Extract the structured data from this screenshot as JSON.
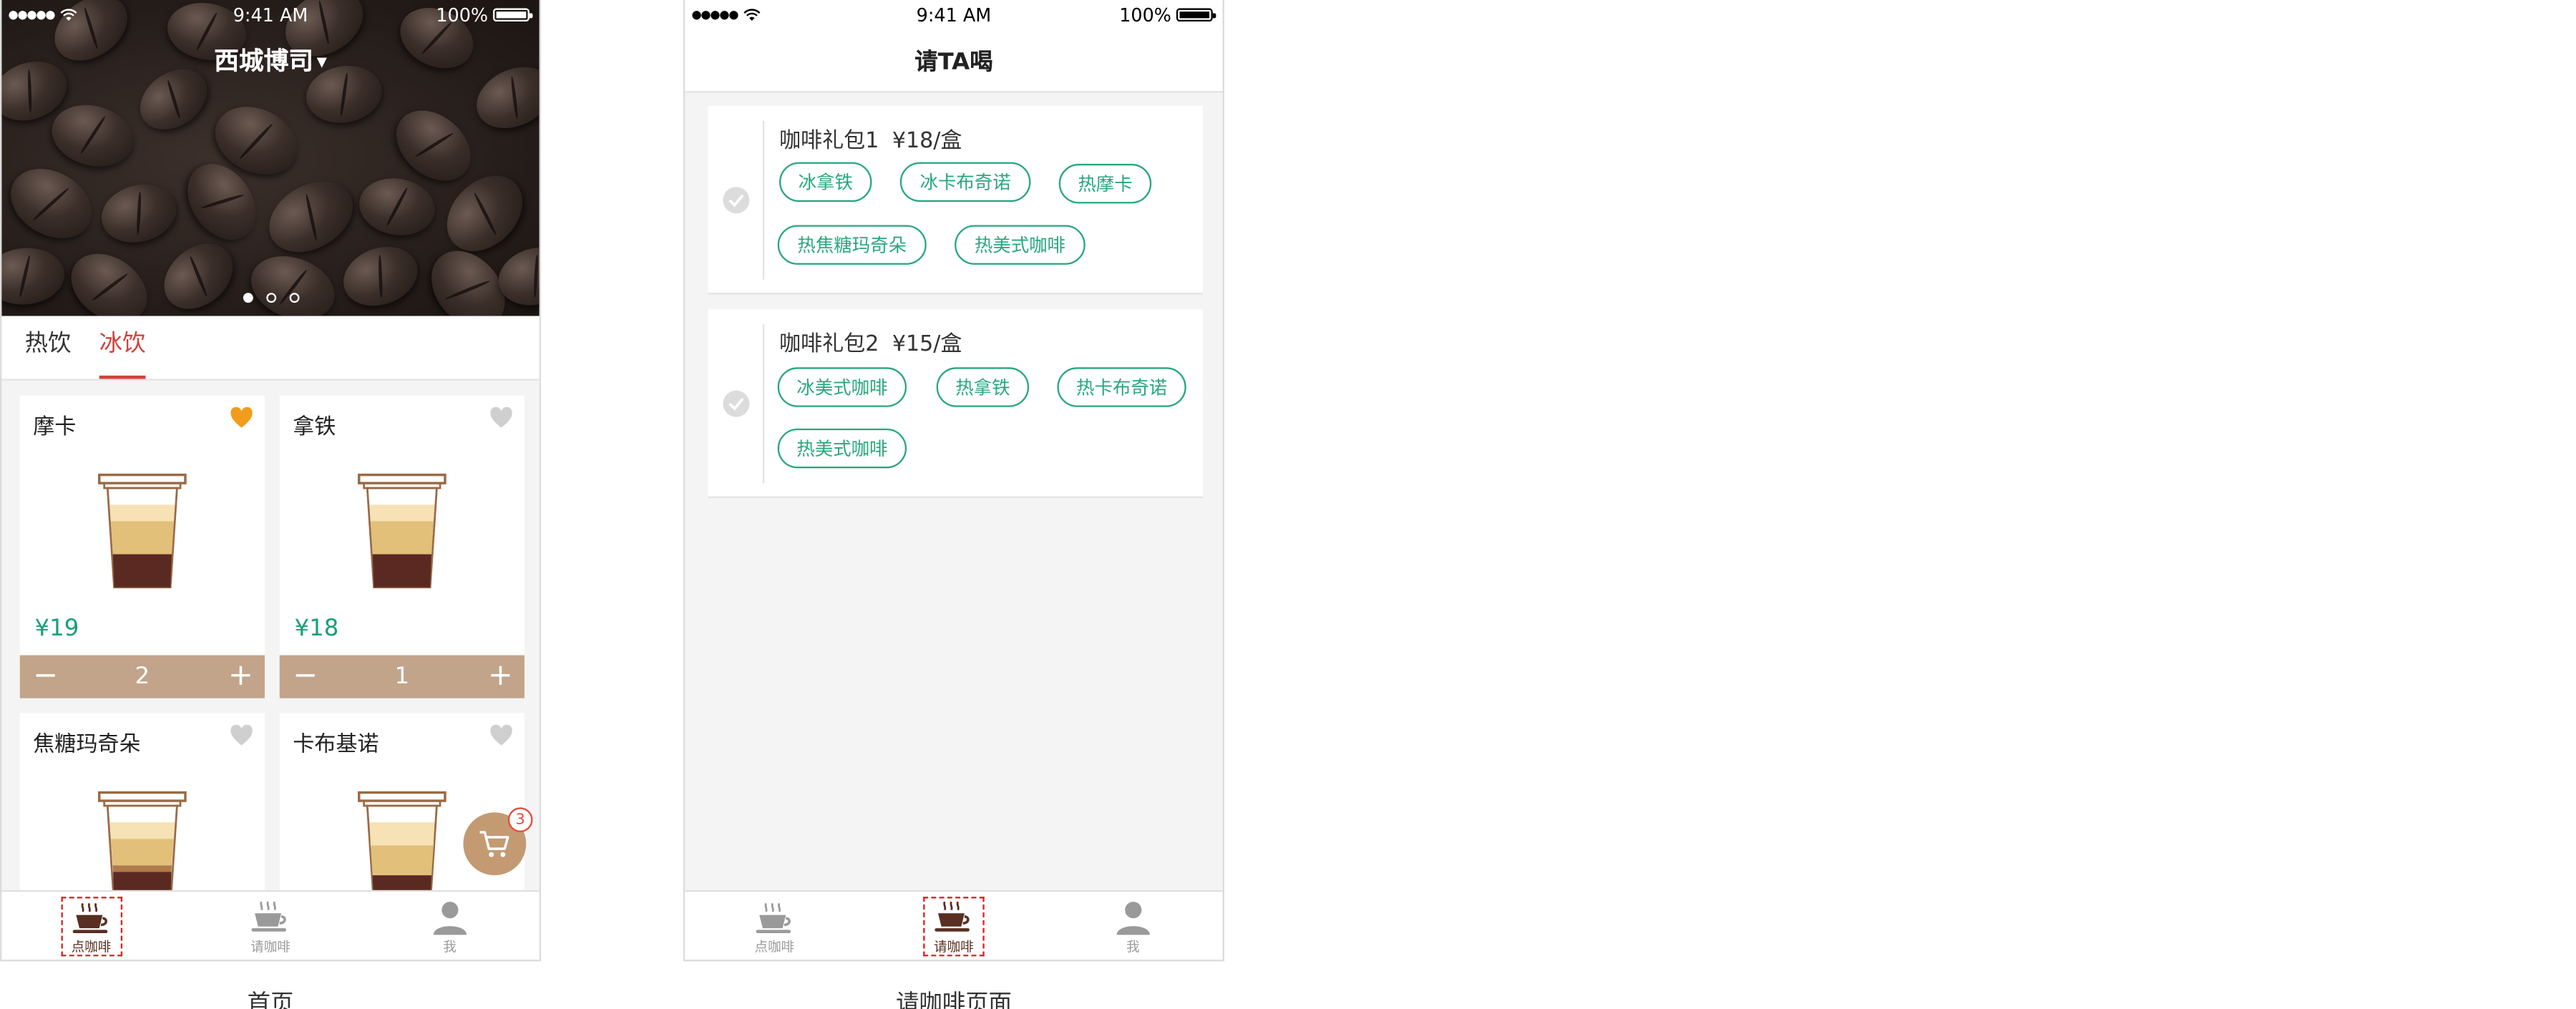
{
  "status_bar": {
    "signal": "●●●●●",
    "time": "9:41 AM",
    "battery": "100%"
  },
  "home": {
    "banner": {
      "city": "西城博司",
      "caret_icon": "caret-down-icon",
      "carousel_total": 3,
      "carousel_active": 1
    },
    "tabs": [
      {
        "label": "热饮",
        "active": false
      },
      {
        "label": "冰饮",
        "active": true
      }
    ],
    "products": [
      {
        "name": "摩卡",
        "price": "¥19",
        "quantity": "2",
        "favorited": true
      },
      {
        "name": "拿铁",
        "price": "¥18",
        "quantity": "1",
        "favorited": false
      },
      {
        "name": "焦糖玛奇朵",
        "favorited": false
      },
      {
        "name": "卡布基诺",
        "favorited": false
      }
    ],
    "stepper": {
      "minus": "−",
      "plus": "+"
    },
    "cart": {
      "icon": "cart-icon",
      "count": "3"
    },
    "caption": "首页"
  },
  "treat": {
    "title": "请TA喝",
    "packs": [
      {
        "name": "咖啡礼包1",
        "price": "¥18/盒",
        "items": [
          "冰拿铁",
          "冰卡布奇诺",
          "热摩卡",
          "热焦糖玛奇朵",
          "热美式咖啡"
        ]
      },
      {
        "name": "咖啡礼包2",
        "price": "¥15/盒",
        "items": [
          "冰美式咖啡",
          "热拿铁",
          "热卡布奇诺",
          "热美式咖啡"
        ]
      }
    ],
    "caption": "请咖啡页面"
  },
  "tabbar": [
    {
      "label": "点咖啡",
      "icon": "coffee-cup-icon"
    },
    {
      "label": "请咖啡",
      "icon": "gift-coffee-icon"
    },
    {
      "label": "我",
      "icon": "user-icon"
    }
  ],
  "colors": {
    "accent_red": "#d0413b",
    "price_green": "#15a07a",
    "chip_green": "#28a77c",
    "stepper_tan": "#c2a48a",
    "cart_tan": "#c49a72",
    "highlight_red": "#e02020"
  }
}
